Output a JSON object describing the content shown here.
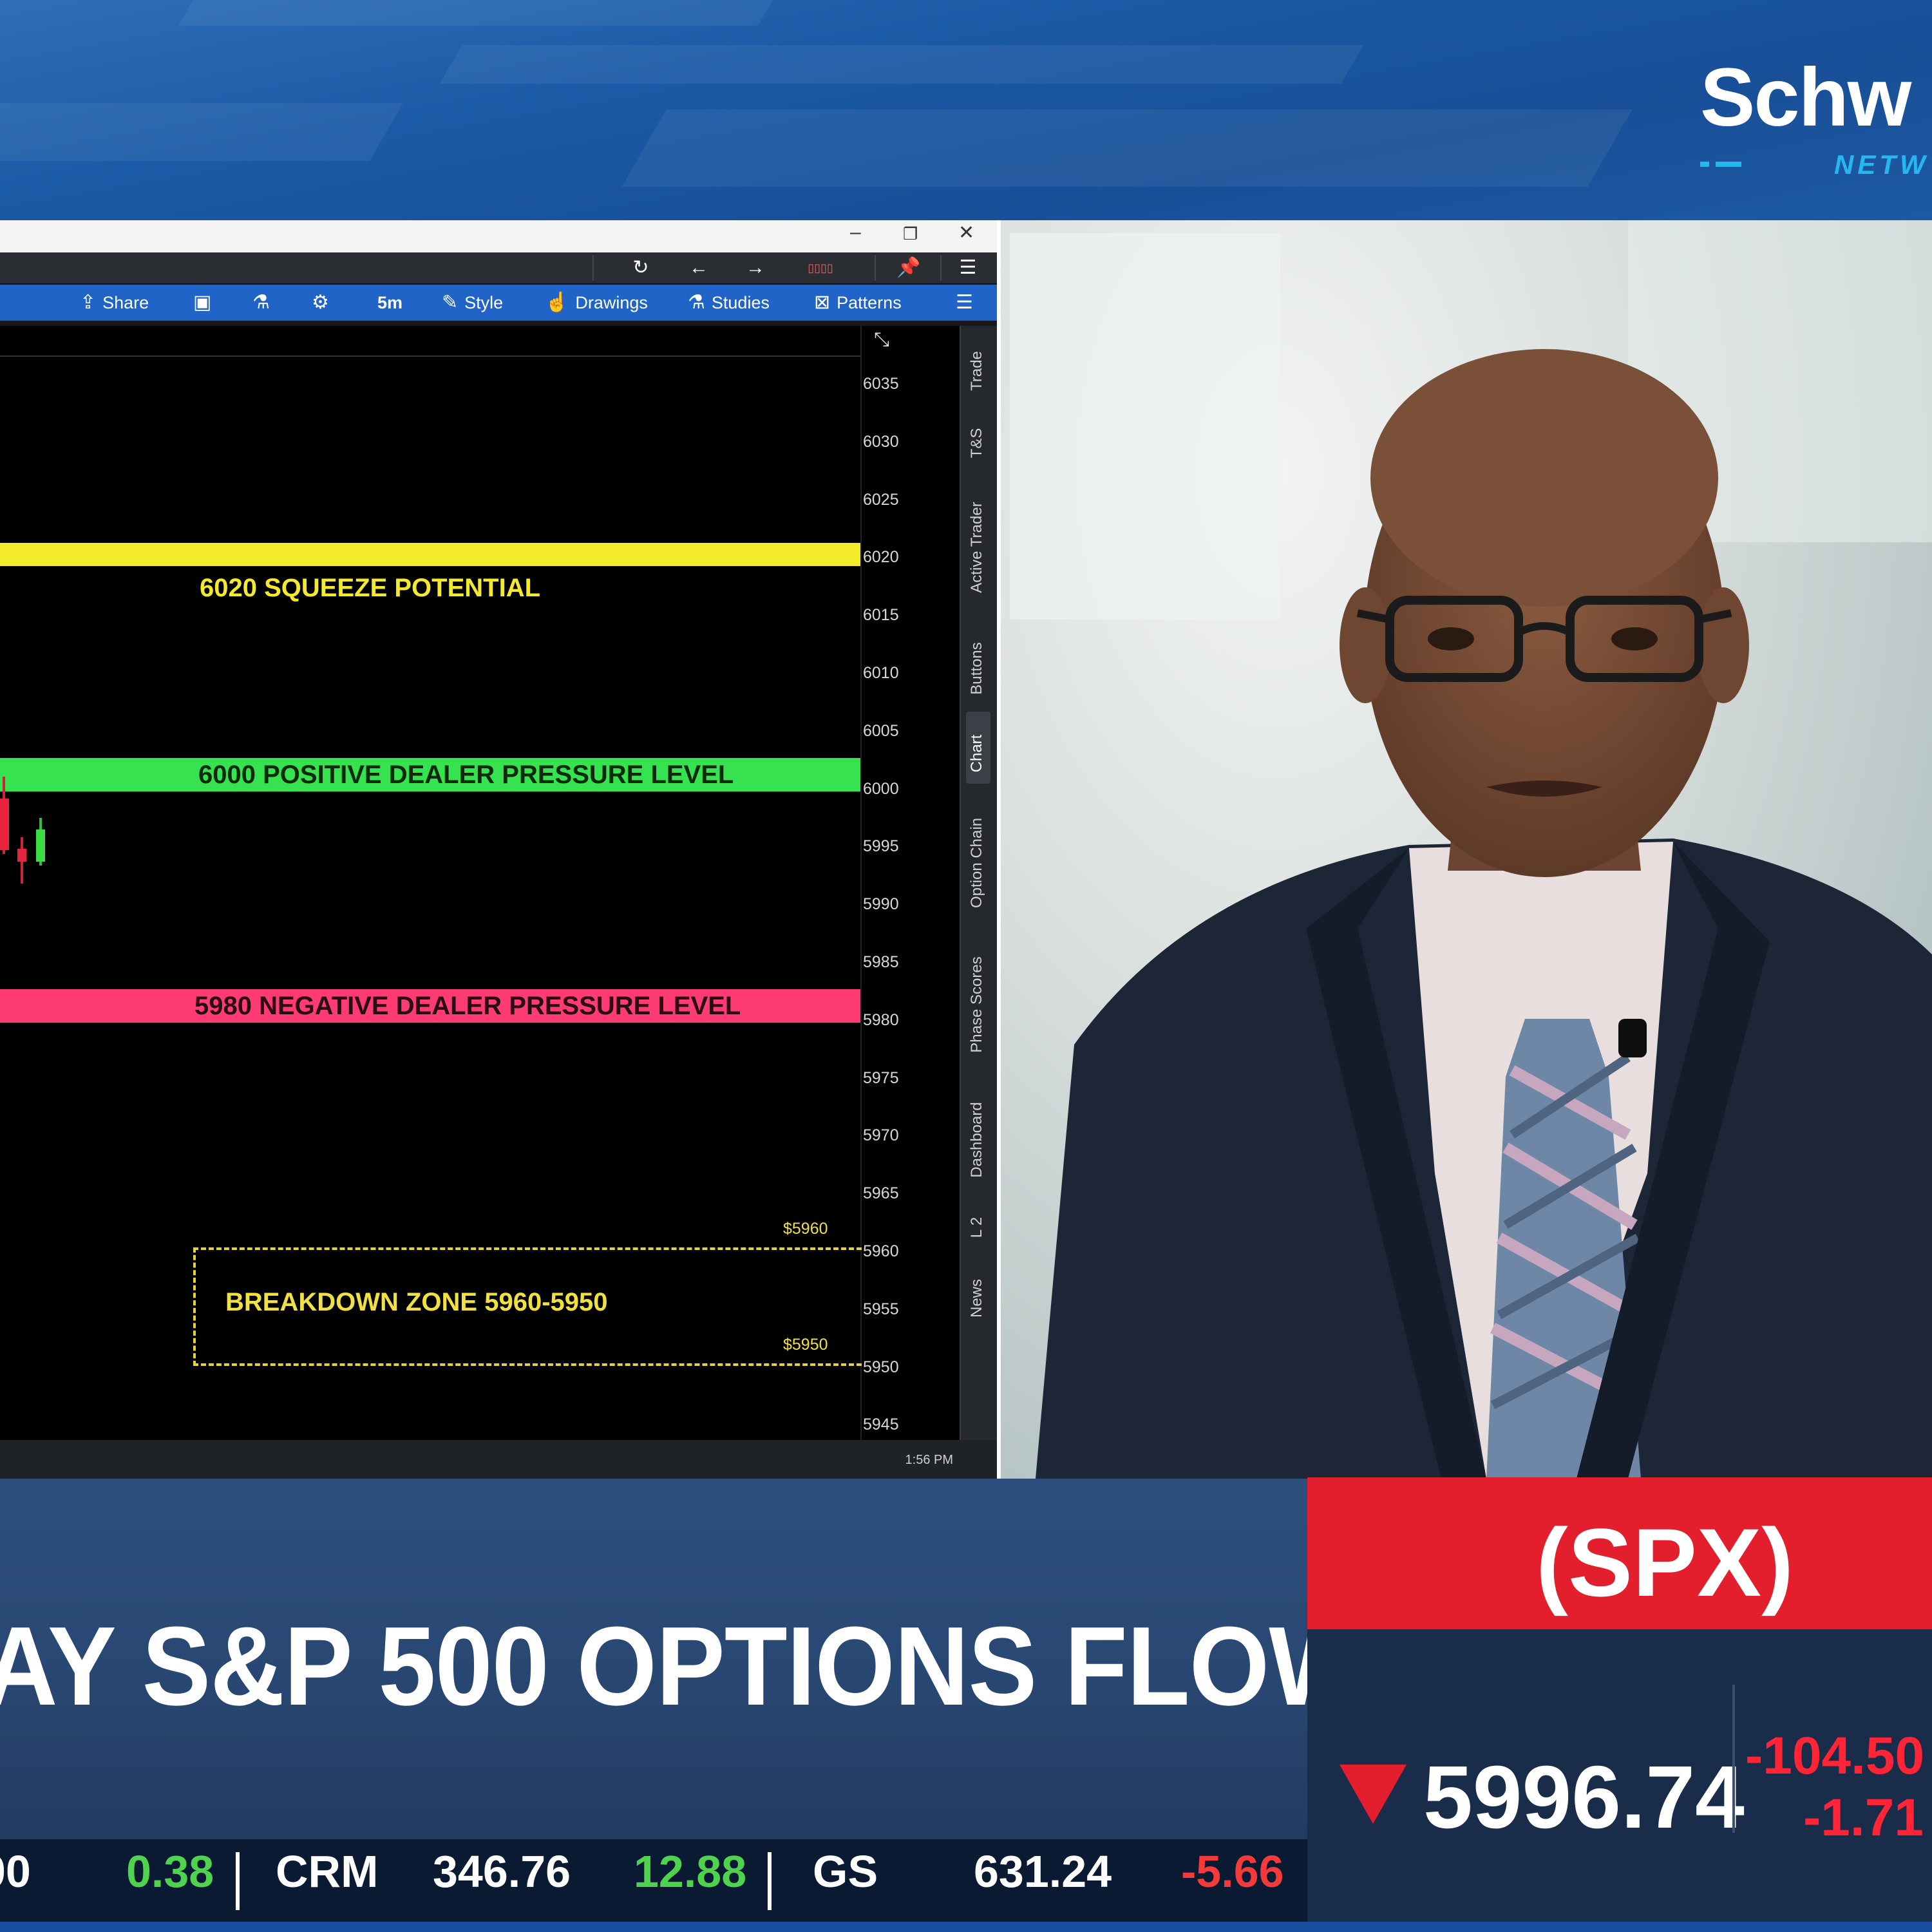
{
  "brand": {
    "name": "Schw",
    "sub": "NETW"
  },
  "window": {
    "controls": {
      "minimize": "–",
      "restore": "❐",
      "close": "✕"
    },
    "toolbar": {
      "share": "Share",
      "interval": "5m",
      "style": "Style",
      "drawings": "Drawings",
      "studies": "Studies",
      "patterns": "Patterns"
    },
    "y_axis_ticks": [
      "6035",
      "6030",
      "6025",
      "6020",
      "6015",
      "6010",
      "6005",
      "6000",
      "5995",
      "5990",
      "5985",
      "5980",
      "5975",
      "5970",
      "5965",
      "5960",
      "5955",
      "5950",
      "5945"
    ],
    "side_tabs": [
      "Trade",
      "T&S",
      "Active Trader",
      "Buttons",
      "Chart",
      "Option Chain",
      "Phase Scores",
      "Dashboard",
      "L 2",
      "News"
    ],
    "time": "1:56 PM"
  },
  "chart_data": {
    "type": "candlestick",
    "levels": [
      {
        "value": 6020,
        "label": "6020 SQUEEZE POTENTIAL",
        "color": "#f4ea2c"
      },
      {
        "value": 6000,
        "label": "6000 POSITIVE DEALER PRESSURE LEVEL",
        "color": "#36e24f"
      },
      {
        "value": 5980,
        "label": "5980 NEGATIVE DEALER PRESSURE LEVEL",
        "color": "#ff3b74"
      }
    ],
    "zone": {
      "label": "BREAKDOWN ZONE 5960-5950",
      "top": 5960,
      "bottom": 5950,
      "top_tag": "$5960",
      "bottom_tag": "$5950",
      "color": "#e7d23a"
    },
    "ylim": [
      5945,
      6035
    ]
  },
  "lower_third": {
    "headline": "AY S&P 500 OPTIONS FLOW"
  },
  "quote": {
    "symbol": "(SPX)",
    "price": "5996.74",
    "change": "-104.50",
    "change_pct": "-1.71",
    "direction_color": "#e31f2e"
  },
  "ticker": [
    {
      "text": "00",
      "cls": ""
    },
    {
      "text": "0.38",
      "cls": "up"
    },
    {
      "text": "CRM",
      "cls": ""
    },
    {
      "text": "346.76",
      "cls": ""
    },
    {
      "text": "12.88",
      "cls": "up"
    },
    {
      "text": "GS",
      "cls": ""
    },
    {
      "text": "631.24",
      "cls": ""
    },
    {
      "text": "-5.66",
      "cls": "dn"
    }
  ]
}
